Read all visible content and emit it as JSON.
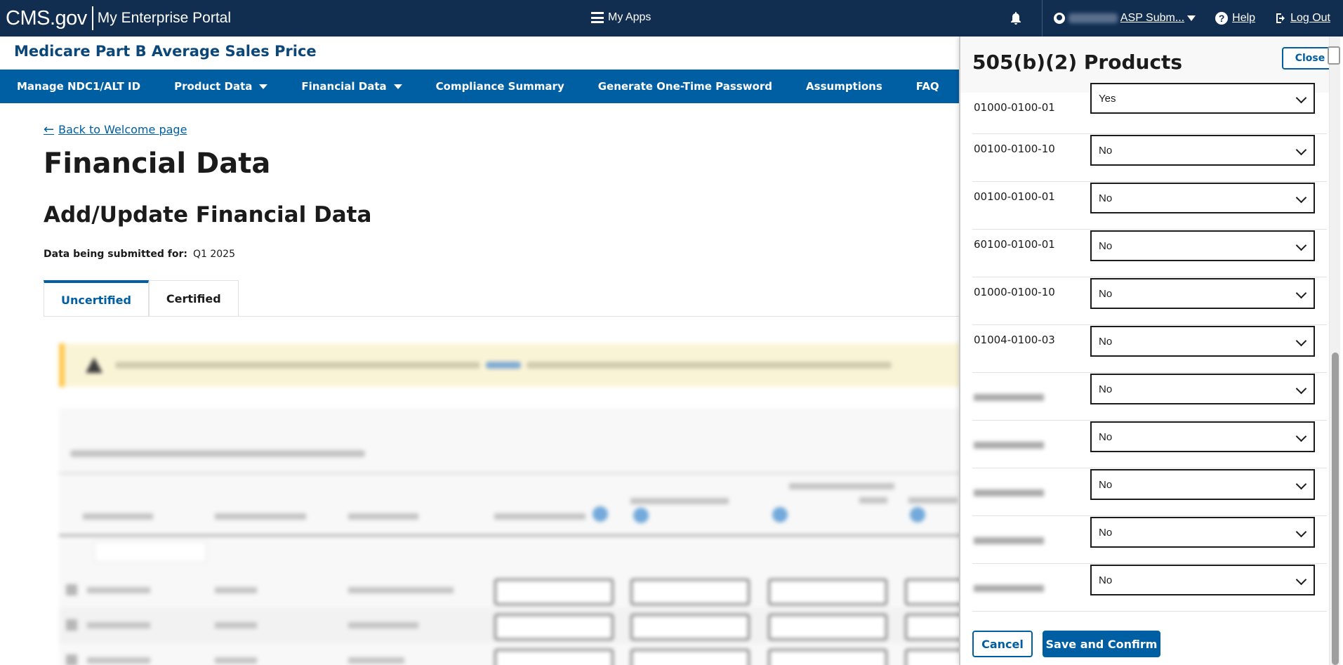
{
  "header": {
    "brand": "CMS.gov",
    "portal": "My Enterprise Portal",
    "my_apps": "My Apps",
    "user_name": "ASP Subm...",
    "help": "Help",
    "logout": "Log Out"
  },
  "app_title": "Medicare Part B Average Sales Price",
  "nav": {
    "items": [
      {
        "label": "Manage NDC1/ALT ID",
        "dropdown": false
      },
      {
        "label": "Product Data",
        "dropdown": true
      },
      {
        "label": "Financial Data",
        "dropdown": true
      },
      {
        "label": "Compliance Summary",
        "dropdown": false
      },
      {
        "label": "Generate One-Time Password",
        "dropdown": false
      },
      {
        "label": "Assumptions",
        "dropdown": false
      },
      {
        "label": "FAQ",
        "dropdown": false
      }
    ]
  },
  "main": {
    "back_link": "Back to Welcome page",
    "title": "Financial Data",
    "subtitle": "Add/Update Financial Data",
    "submitted_label": "Data being submitted for:",
    "submitted_value": "Q1 2025",
    "tabs": [
      {
        "label": "Uncertified",
        "active": true
      },
      {
        "label": "Certified",
        "active": false
      }
    ]
  },
  "panel": {
    "title": "505(b)(2) Products",
    "close": "Close",
    "products": [
      {
        "ndc": "01000-0100-01",
        "value": "Yes",
        "obscured": false
      },
      {
        "ndc": "00100-0100-10",
        "value": "No",
        "obscured": false
      },
      {
        "ndc": "00100-0100-01",
        "value": "No",
        "obscured": false
      },
      {
        "ndc": "60100-0100-01",
        "value": "No",
        "obscured": false
      },
      {
        "ndc": "01000-0100-10",
        "value": "No",
        "obscured": false
      },
      {
        "ndc": "01004-0100-03",
        "value": "No",
        "obscured": false
      },
      {
        "ndc": "",
        "value": "No",
        "obscured": true
      },
      {
        "ndc": "",
        "value": "No",
        "obscured": true
      },
      {
        "ndc": "",
        "value": "No",
        "obscured": true
      },
      {
        "ndc": "",
        "value": "No",
        "obscured": true
      },
      {
        "ndc": "",
        "value": "No",
        "obscured": true
      }
    ],
    "cancel": "Cancel",
    "save": "Save and Confirm"
  },
  "colors": {
    "header_bg": "#112e51",
    "nav_bg": "#005ea2",
    "primary": "#005ea2",
    "title_blue": "#0b4778",
    "alert_bg": "#faf3d1",
    "alert_border": "#ffbe2e"
  }
}
